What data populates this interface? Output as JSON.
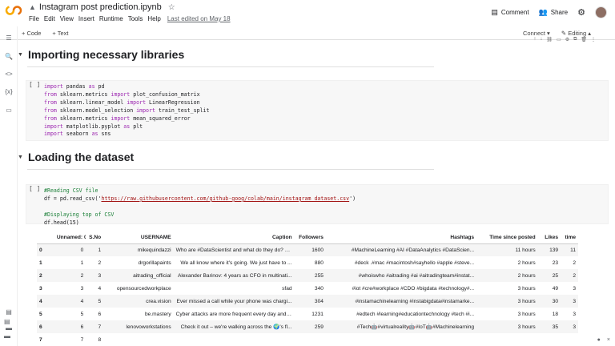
{
  "doc": {
    "title": "Instagram post prediction.ipynb",
    "menus": [
      "File",
      "Edit",
      "View",
      "Insert",
      "Runtime",
      "Tools",
      "Help"
    ],
    "last_edited": "Last edited on May 18"
  },
  "header": {
    "comment": "Comment",
    "share": "Share"
  },
  "toolbar": {
    "code": "+ Code",
    "text": "+ Text",
    "connect": "Connect",
    "editing": "Editing"
  },
  "sections": {
    "s1": "Importing necessary libraries",
    "s2": "Loading the dataset"
  },
  "cells": {
    "run_label": "[ ]",
    "c1": [
      [
        "kw:import",
        " pandas ",
        "kw:as",
        " pd"
      ],
      [
        "kw:from",
        " sklearn.metrics ",
        "kw:import",
        " plot_confusion_matrix"
      ],
      [
        "kw:from",
        " sklearn.linear_model ",
        "kw:import",
        " LinearRegression"
      ],
      [
        "kw:from",
        " sklearn.model_selection ",
        "kw:import",
        " train_test_split"
      ],
      [
        "kw:from",
        " sklearn.metrics ",
        "kw:import",
        " mean_squared_error"
      ],
      [
        "kw:import",
        " matplotlib.pyplot ",
        "kw:as",
        " plt"
      ],
      [
        "kw:import",
        " seaborn ",
        "kw:as",
        " sns"
      ]
    ],
    "c2": [
      [
        "cm:#Reading CSV file"
      ],
      [
        "df = pd.read_csv('",
        "str:https://raw.githubusercontent.com/github-goog/colab/main/instagram_dataset.csv",
        "')"
      ],
      [
        ""
      ],
      [
        "cm:#Displaying top of CSV"
      ],
      [
        "df.head(15)"
      ]
    ]
  },
  "table": {
    "headers": [
      "",
      "Unnamed: 0",
      "S.No",
      "USERNAME",
      "Caption",
      "Followers",
      "Hashtags",
      "Time since posted",
      "Likes",
      "time"
    ],
    "rows": [
      [
        "0",
        "0",
        "1",
        "mikequindazzi",
        "Who are #DataScientist and what do they do? >>...",
        "1600",
        "#MachineLearning #AI #DataAnalytics #DataScien...",
        "11 hours",
        "139",
        "11"
      ],
      [
        "1",
        "1",
        "2",
        "drgorillapaints",
        "We all know where it's going. We just have to ...",
        "880",
        "#deck .#mac #macintosh#sayhello #apple #steve...",
        "2 hours",
        "23",
        "2"
      ],
      [
        "2",
        "2",
        "3",
        "aitrading_official",
        "Alexander Barinov: 4 years as CFO in multinati...",
        "255",
        "#whoiswho #aitrading #ai #aitradingteam#instat...",
        "2 hours",
        "25",
        "2"
      ],
      [
        "3",
        "3",
        "4",
        "opensourcedworkplace",
        "sfad",
        "340",
        "#iot #cre#workplace #CDO #bigdata #technology#...",
        "3 hours",
        "49",
        "3"
      ],
      [
        "4",
        "4",
        "5",
        "crea.vision",
        "Ever missed a call while your phone was chargi...",
        "304",
        "#instamachinelearning #instabigdata#instamarke...",
        "3 hours",
        "30",
        "3"
      ],
      [
        "5",
        "5",
        "6",
        "be.mastery",
        "Cyber attacks are more frequent every day and ...",
        "1231",
        "#edtech #learning#educationtechnology #tech #i...",
        "3 hours",
        "18",
        "3"
      ],
      [
        "6",
        "6",
        "7",
        "lenovoworkstations",
        "Check it out – we're walking across the 🌍's fl...",
        "259",
        "#Tech🤖#virtualreality🤖#IoT🤖#Machinelearning",
        "3 hours",
        "35",
        "3"
      ],
      [
        "7",
        "7",
        "8",
        "",
        "",
        "",
        "",
        "",
        "",
        ""
      ]
    ]
  }
}
